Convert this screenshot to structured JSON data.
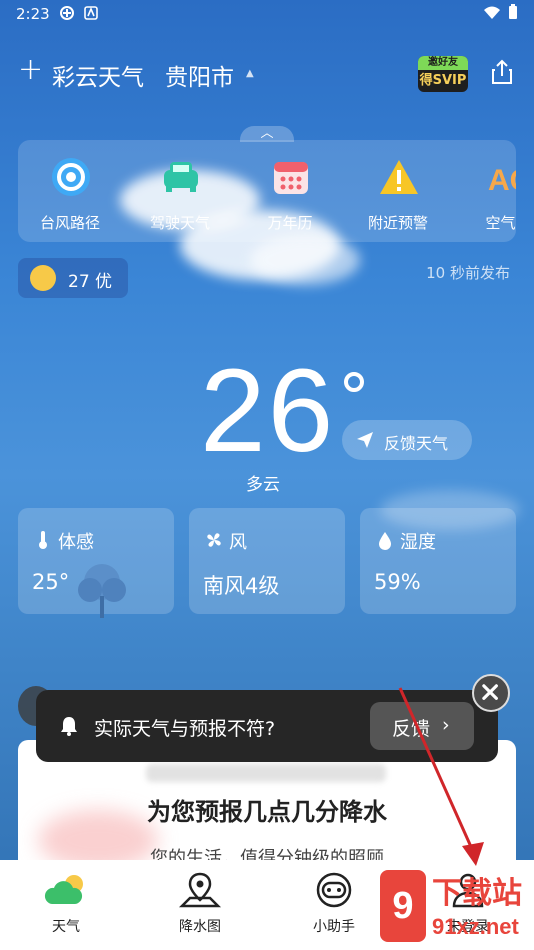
{
  "status_bar": {
    "time": "2:23"
  },
  "header": {
    "app_title": "彩云天气",
    "city": "贵阳市",
    "vip_top": "邀好友",
    "vip_bottom": "得SVIP"
  },
  "toolbar": {
    "items": [
      {
        "label": "台风路径",
        "icon": "typhoon-icon"
      },
      {
        "label": "驾驶天气",
        "icon": "car-icon"
      },
      {
        "label": "万年历",
        "icon": "calendar-icon"
      },
      {
        "label": "附近预警",
        "icon": "warning-icon"
      },
      {
        "label": "空气质",
        "icon": "air-quality-icon"
      }
    ]
  },
  "aqi": {
    "text": "27 优"
  },
  "publish_time": "10 秒前发布",
  "current": {
    "temperature": "26",
    "condition": "多云",
    "feedback_label": "反馈天气"
  },
  "cards": [
    {
      "label": "体感",
      "value": "25°",
      "icon": "thermometer-icon"
    },
    {
      "label": "风",
      "value": "南风4级",
      "icon": "fan-icon"
    },
    {
      "label": "湿度",
      "value": "59%",
      "icon": "droplet-icon"
    }
  ],
  "promo": {
    "heading": "为您预报几点几分降水",
    "subtitle": "您的生活，值得分钟级的照顾"
  },
  "toast": {
    "message": "实际天气与预报不符?",
    "button": "反馈",
    "chevron": "›"
  },
  "nav": {
    "items": [
      {
        "label": "天气",
        "icon": "weather-icon"
      },
      {
        "label": "降水图",
        "icon": "map-pin-icon"
      },
      {
        "label": "小助手",
        "icon": "assistant-icon"
      },
      {
        "label": "未登录",
        "icon": "user-icon"
      }
    ]
  },
  "watermark": {
    "logo": "9",
    "line1": "下载站",
    "line2": "91xz.net"
  },
  "colors": {
    "accent": "#2b6dc4",
    "nav_active": "#3cbf6a",
    "annotation": "#d0262a",
    "watermark": "#e8453c"
  }
}
